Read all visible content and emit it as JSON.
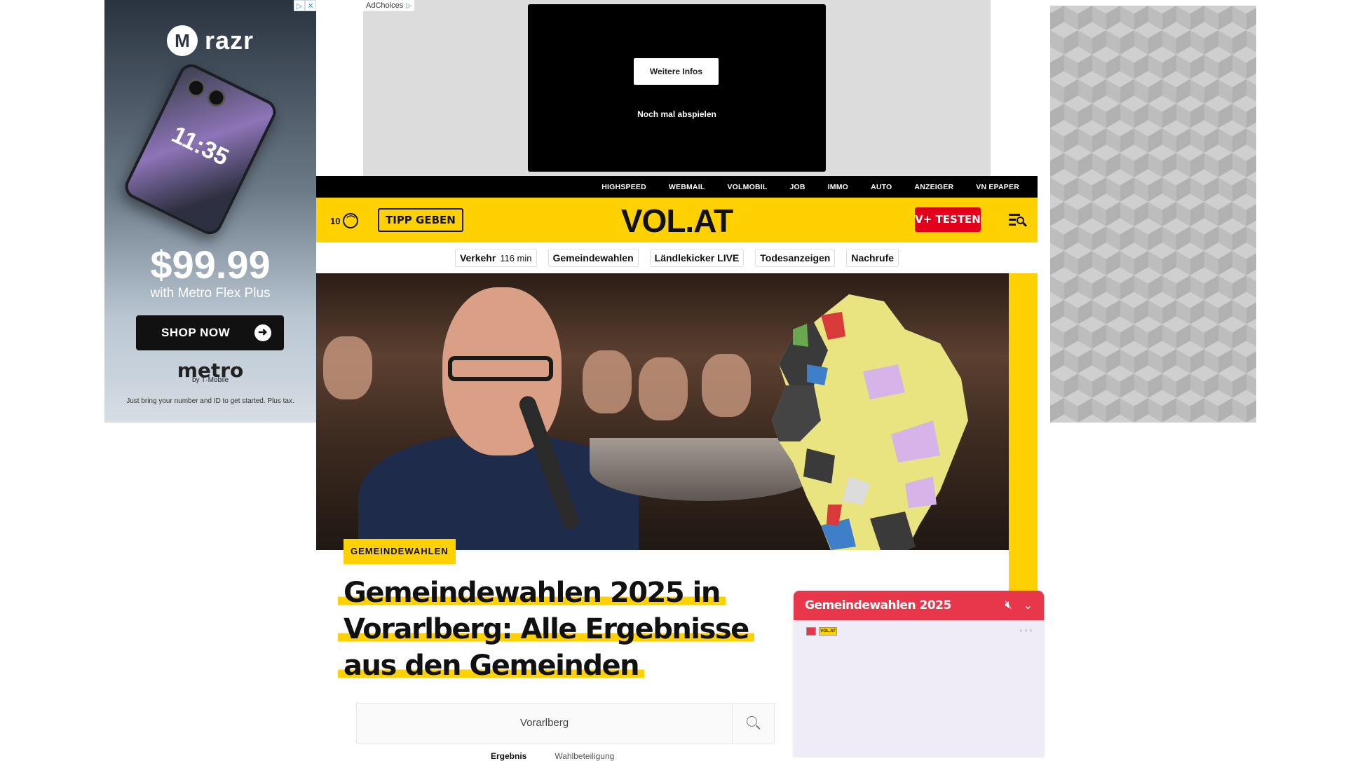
{
  "left_ad": {
    "brand": "razr",
    "phone_time": "11:35",
    "price": "$99.99",
    "price_sub": "with Metro Flex Plus",
    "cta": "SHOP NOW",
    "sponsor": "metro",
    "sponsor_sub": "by T·Mobile",
    "fine_print": "Just bring your number and ID to get started. Plus tax.",
    "ad_icons": [
      "▷",
      "✕"
    ]
  },
  "top_ad": {
    "adchoices": "AdChoices",
    "more_info": "Weitere Infos",
    "replay": "Noch mal abspielen"
  },
  "service_nav": [
    "HIGHSPEED",
    "WEBMAIL",
    "VOLMOBIL",
    "JOB",
    "IMMO",
    "AUTO",
    "ANZEIGER",
    "VN EPAPER"
  ],
  "header": {
    "temperature": "10",
    "tip_button": "TIPP GEBEN",
    "logo": "VOL.AT",
    "subscribe_button": "V+ TESTEN"
  },
  "topics": [
    {
      "label": "Verkehr",
      "extra": "116 min"
    },
    {
      "label": "Gemeindewahlen",
      "extra": ""
    },
    {
      "label": "Ländlekicker LIVE",
      "extra": ""
    },
    {
      "label": "Todesanzeigen",
      "extra": ""
    },
    {
      "label": "Nachrufe",
      "extra": ""
    }
  ],
  "article": {
    "category": "GEMEINDEWAHLEN",
    "headline": "Gemeindewahlen 2025 in Vorarlberg: Alle Ergebnisse aus den Gemeinden"
  },
  "search": {
    "value": "Vorarlberg"
  },
  "result_tabs": [
    "Ergebnis",
    "Wahlbeteiligung"
  ],
  "player": {
    "title": "Gemeindewahlen 2025",
    "badge": "VOL.AT"
  },
  "colors": {
    "brand_yellow": "#ffd100",
    "accent_red": "#e2001a",
    "player_red": "#e8364a"
  }
}
